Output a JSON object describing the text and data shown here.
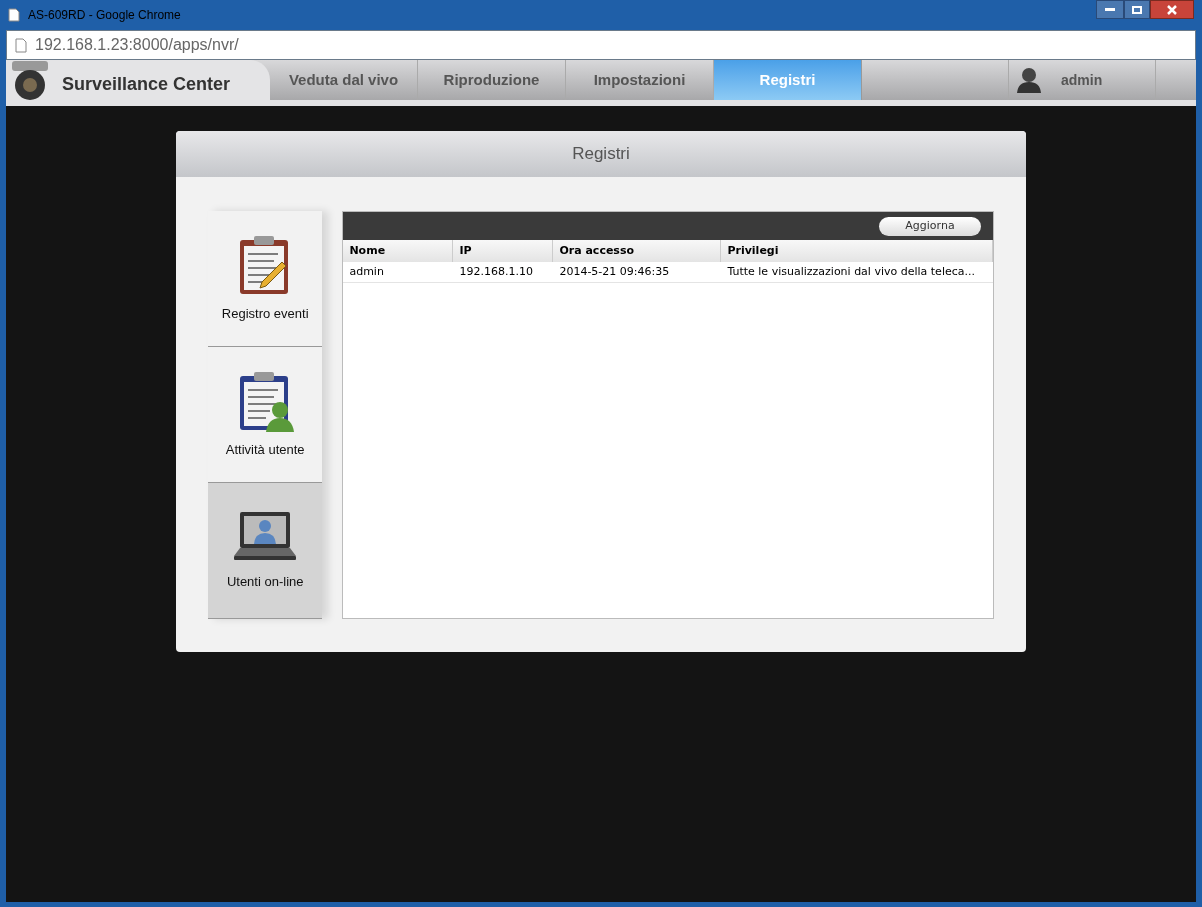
{
  "window": {
    "title": "AS-609RD - Google Chrome"
  },
  "address_bar": {
    "url": "192.168.1.23:8000/apps/nvr/"
  },
  "app": {
    "title": "Surveillance Center"
  },
  "tabs": [
    {
      "label": "Veduta dal vivo",
      "selected": false
    },
    {
      "label": "Riproduzione",
      "selected": false
    },
    {
      "label": "Impostazioni",
      "selected": false
    },
    {
      "label": "Registri",
      "selected": true
    }
  ],
  "user": {
    "name": "admin"
  },
  "panel": {
    "title": "Registri"
  },
  "sidebar": {
    "items": [
      {
        "kind": "events",
        "label": "Registro eventi",
        "selected": false
      },
      {
        "kind": "activity",
        "label": "Attività utente",
        "selected": false
      },
      {
        "kind": "online",
        "label": "Utenti on-line",
        "selected": true
      }
    ]
  },
  "toolbar": {
    "refresh_button": "Aggiorna"
  },
  "table": {
    "columns": [
      "Nome",
      "IP",
      "Ora accesso",
      "Privilegi"
    ],
    "rows": [
      [
        "admin",
        "192.168.1.10",
        "2014-5-21 09:46:35",
        "Tutte le visualizzazioni dal vivo della teleca..."
      ]
    ]
  }
}
